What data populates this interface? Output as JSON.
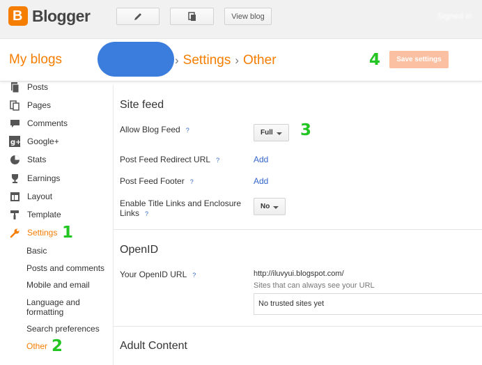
{
  "topbar": {
    "logo_letter": "B",
    "logo_text": "Blogger",
    "view_blog_label": "View blog",
    "user_name": "Signed in"
  },
  "header": {
    "my_blogs": "My blogs",
    "crumb_sep": "›",
    "crumb_settings": "Settings",
    "crumb_other": "Other",
    "save_label": "Save settings"
  },
  "annotations": {
    "n1": "1",
    "n2": "2",
    "n3": "3",
    "n4": "4"
  },
  "sidebar": {
    "items": [
      {
        "label": "Posts"
      },
      {
        "label": "Pages"
      },
      {
        "label": "Comments"
      },
      {
        "label": "Google+"
      },
      {
        "label": "Stats"
      },
      {
        "label": "Earnings"
      },
      {
        "label": "Layout"
      },
      {
        "label": "Template"
      },
      {
        "label": "Settings"
      }
    ],
    "subitems": [
      {
        "label": "Basic"
      },
      {
        "label": "Posts and comments"
      },
      {
        "label": "Mobile and email"
      },
      {
        "label": "Language and formatting"
      },
      {
        "label": "Search preferences"
      },
      {
        "label": "Other"
      }
    ]
  },
  "main": {
    "site_feed": {
      "title": "Site feed",
      "allow_label": "Allow Blog Feed",
      "allow_value": "Full",
      "redirect_label": "Post Feed Redirect URL",
      "redirect_link": "Add",
      "footer_label": "Post Feed Footer",
      "footer_link": "Add",
      "enclosure_label": "Enable Title Links and Enclosure Links",
      "enclosure_value": "No"
    },
    "openid": {
      "title": "OpenID",
      "url_label": "Your OpenID URL",
      "url_value": "http://iluvyui.blogspot.com/",
      "hint": "Sites that can always see your URL",
      "trusted": "No trusted sites yet"
    },
    "adult": {
      "title": "Adult Content"
    },
    "help_glyph": "?"
  },
  "colors": {
    "accent": "#f57d00",
    "link": "#3366cc",
    "annotation": "#22c522",
    "save_button": "#fbbfa1"
  }
}
